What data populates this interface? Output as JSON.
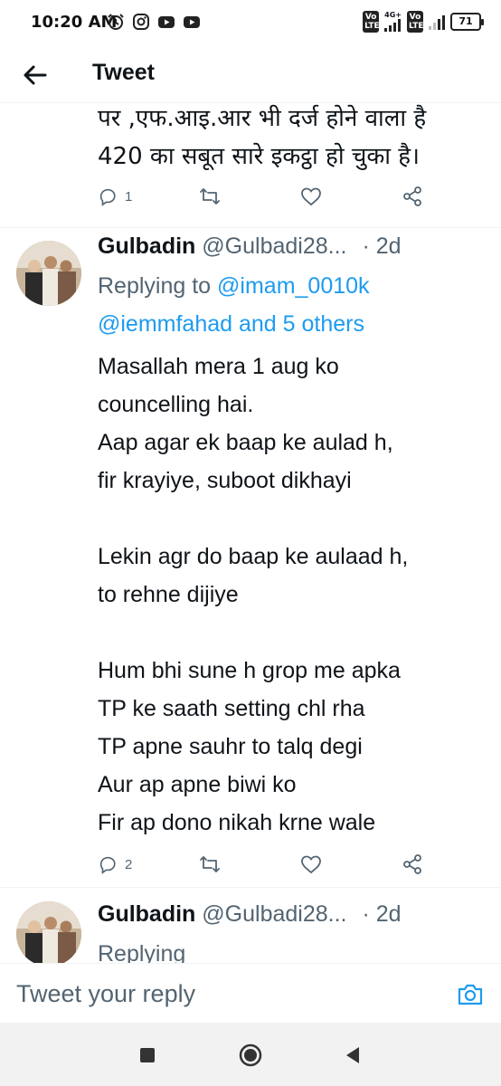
{
  "status_bar": {
    "time": "10:20 AM",
    "battery": "71",
    "network": "4G+",
    "lte_label": "Vo LTE",
    "icons": [
      "alarm-icon",
      "instagram-icon",
      "youtube-icon",
      "youtube-icon"
    ]
  },
  "header": {
    "title": "Tweet",
    "back_icon": "arrow-left-icon"
  },
  "previous_tweet": {
    "text_lines": [
      "पर ,एफ.आइ.आर भी दर्ज होने वाला है",
      "420 का सबूत सारे इकट्ठा हो चुका है।"
    ],
    "reply_count": "1"
  },
  "reply_tweet": {
    "name": "Gulbadin",
    "handle": "@Gulbadi28...",
    "separator": "·",
    "time": "2d",
    "replying_to_label": "Replying to",
    "mention_1": "@imam_0010k",
    "mention_2": "@iemmfahad and 5 others",
    "body": "Masallah mera 1 aug ko\ncouncelling hai.\nAap agar ek baap ke aulad h,\nfir krayiye, suboot dikhayi\n\nLekin agr do baap ke aulaad h,\nto rehne dijiye\n\nHum bhi sune h grop me apka\nTP ke saath setting chl rha\nTP apne sauhr to talq degi\nAur ap apne biwi ko\nFir ap dono nikah krne wale",
    "reply_count": "2"
  },
  "next_tweet": {
    "name": "Gulbadin",
    "handle": "@Gulbadi28...",
    "separator": "·",
    "time": "2d",
    "replying_partial": "Replying"
  },
  "reply_bar": {
    "placeholder": "Tweet your reply"
  },
  "colors": {
    "accent": "#1d9bf0",
    "text_primary": "#0f1419",
    "text_secondary": "#536471",
    "divider": "#eff3f4"
  }
}
